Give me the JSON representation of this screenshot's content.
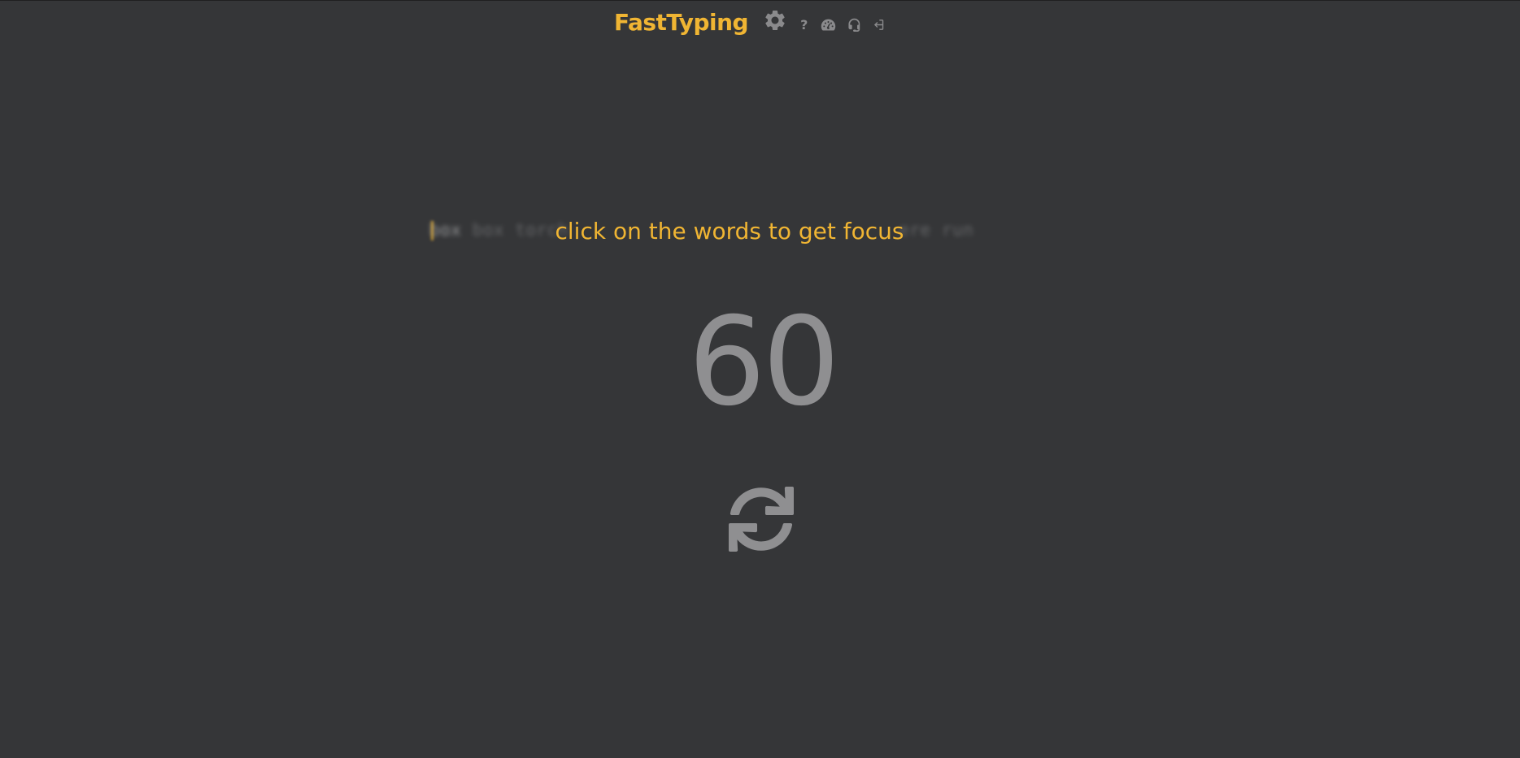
{
  "header": {
    "logo": "FastTyping",
    "help_label": "?",
    "icons": [
      "gear-icon",
      "question-icon",
      "speedometer-icon",
      "headset-icon",
      "sign-in-icon"
    ]
  },
  "typing": {
    "words": [
      "box",
      "box",
      "torch",
      "",
      "",
      "",
      "",
      "",
      "ere",
      "run"
    ],
    "words_visible_text": "box box torch",
    "words_tail_text": "ere run",
    "focus_message": "click on the words to get focus"
  },
  "timer": {
    "value": "60"
  },
  "restart": {
    "icon": "refresh-icon"
  },
  "colors": {
    "background": "#353638",
    "accent": "#f0b533",
    "muted": "#8f8f91"
  }
}
